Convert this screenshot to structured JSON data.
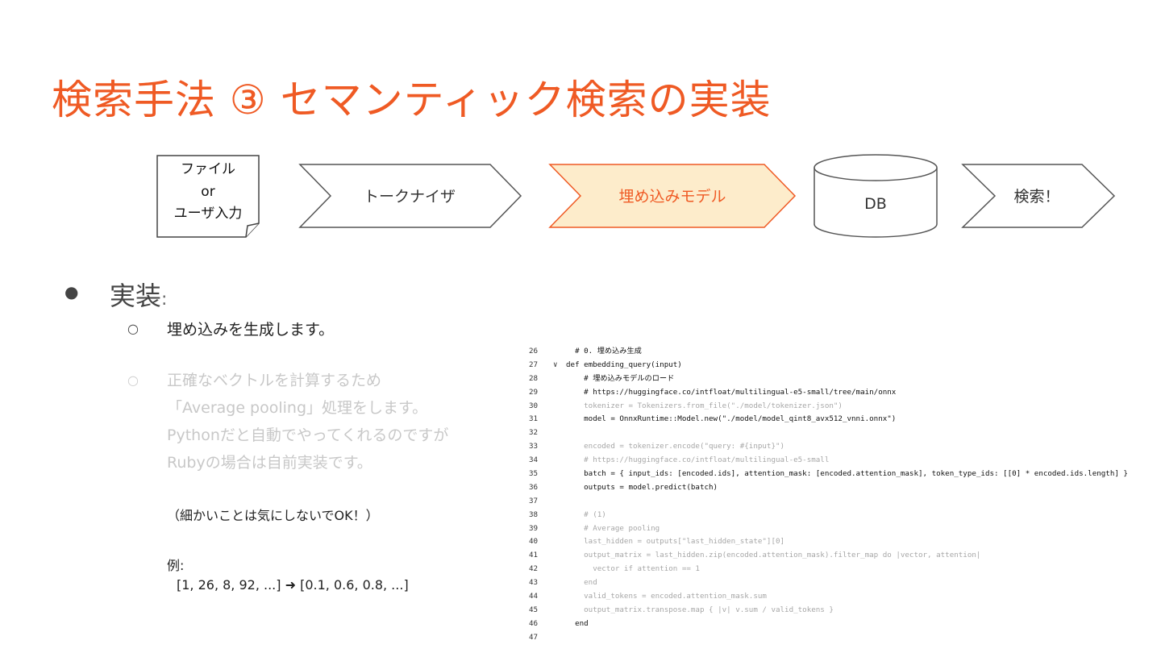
{
  "title": "検索手法 ③ セマンティック検索の実装",
  "flow": {
    "input_lines": [
      "ファイル",
      "or",
      "ユーザ入力"
    ],
    "tokenizer": "トークナイザ",
    "embedding_model": "埋め込みモデル",
    "db": "DB",
    "search": "検索！"
  },
  "bullets": {
    "heading": "実装",
    "heading_colon": ":",
    "item1": "埋め込みを生成します。",
    "item2_lines": [
      "正確なベクトルを計算するため",
      "「Average pooling」処理をします。",
      "Pythonだと自動でやってくれるのですが",
      "Rubyの場合は自前実装です。"
    ],
    "note": "（細かいことは気にしないでOK！）",
    "example_label": "例:",
    "example_text": "[1, 26, 8, 92, ...] ➜ [0.1, 0.6, 0.8, ...]"
  },
  "colors": {
    "accent": "#ef5a24",
    "highlight_fill": "#fdeccb",
    "faded_text": "#c8c8c8"
  },
  "code_lines": [
    {
      "n": "26",
      "text": "  # 0. 埋め込み生成"
    },
    {
      "n": "27",
      "text": "def embedding_query(input)"
    },
    {
      "n": "28",
      "text": "    # 埋め込みモデルのロード"
    },
    {
      "n": "29",
      "text": "    # https://huggingface.co/intfloat/multilingual-e5-small/tree/main/onnx"
    },
    {
      "n": "30",
      "text": "    tokenizer = Tokenizers.from_file(\"./model/tokenizer.json\")"
    },
    {
      "n": "31",
      "text": "    model = OnnxRuntime::Model.new(\"./model/model_qint8_avx512_vnni.onnx\")"
    },
    {
      "n": "32",
      "text": ""
    },
    {
      "n": "33",
      "text": "    encoded = tokenizer.encode(\"query: #{input}\")"
    },
    {
      "n": "34",
      "text": "    # https://huggingface.co/intfloat/multilingual-e5-small"
    },
    {
      "n": "35",
      "text": "    batch = { input_ids: [encoded.ids], attention_mask: [encoded.attention_mask], token_type_ids: [[0] * encoded.ids.length] }"
    },
    {
      "n": "36",
      "text": "    outputs = model.predict(batch)"
    },
    {
      "n": "37",
      "text": ""
    },
    {
      "n": "38",
      "text": "    # (1)"
    },
    {
      "n": "39",
      "text": "    # Average pooling"
    },
    {
      "n": "40",
      "text": "    last_hidden = outputs[\"last_hidden_state\"][0]"
    },
    {
      "n": "41",
      "text": "    output_matrix = last_hidden.zip(encoded.attention_mask).filter_map do |vector, attention|"
    },
    {
      "n": "42",
      "text": "      vector if attention == 1"
    },
    {
      "n": "43",
      "text": "    end"
    },
    {
      "n": "44",
      "text": "    valid_tokens = encoded.attention_mask.sum"
    },
    {
      "n": "45",
      "text": "    output_matrix.transpose.map { |v| v.sum / valid_tokens }"
    },
    {
      "n": "46",
      "text": "  end"
    },
    {
      "n": "47",
      "text": ""
    }
  ]
}
